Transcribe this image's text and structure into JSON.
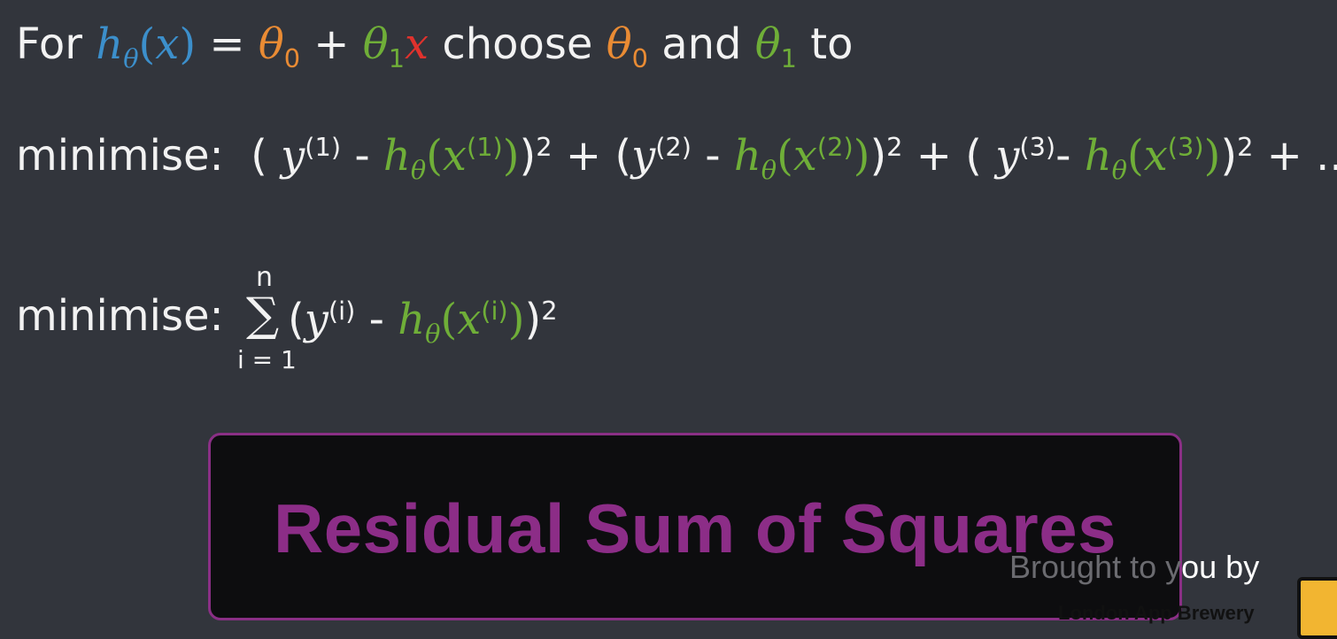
{
  "line1": {
    "for": "For",
    "h": "h",
    "theta": "θ",
    "x": "x",
    "open": "(",
    "close": ")",
    "eq": " = ",
    "zero": "0",
    "one": "1",
    "plus": " + ",
    "choose": " choose ",
    "and": " and ",
    "to": " to"
  },
  "line2": {
    "label": "minimise:",
    "terms": [
      "(1)",
      "(2)",
      "(3)"
    ],
    "y": "y",
    "minus": " - ",
    "minus_tight": "- ",
    "sq": "2",
    "plus": " + ",
    "open_paren": "( ",
    "tail": " + ..."
  },
  "line3": {
    "label": "minimise:",
    "sigma": "∑",
    "upper": "n",
    "lower": "i = 1",
    "sup_i": "(i)"
  },
  "banner": {
    "title": "Residual Sum of Squares"
  },
  "credit": {
    "text_faded": "Brought to y",
    "text_visible": "ou by",
    "brand": "London App Brewery"
  }
}
